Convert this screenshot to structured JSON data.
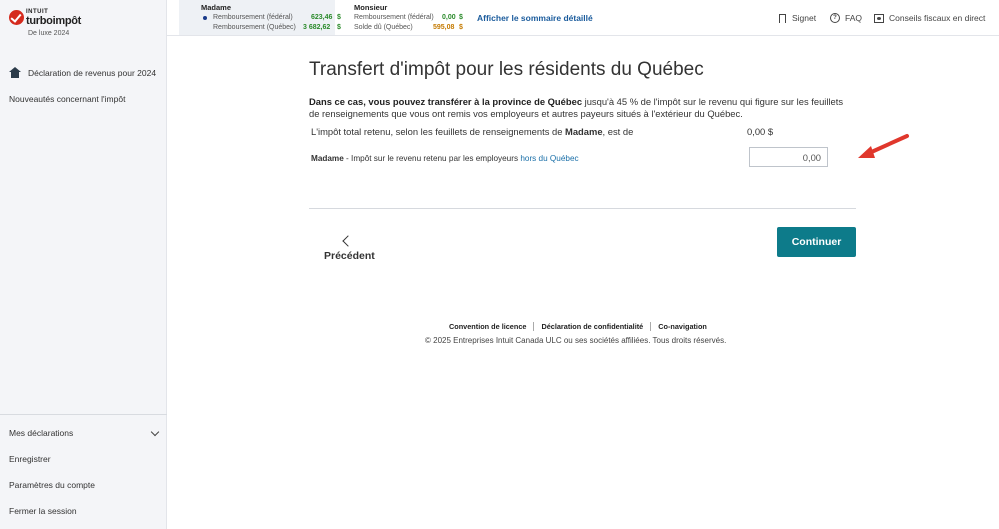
{
  "brand": {
    "intuit": "INTUIT",
    "product": "turboimpôt",
    "edition": "De luxe 2024"
  },
  "sidebar": {
    "items": [
      {
        "label": "Déclaration de revenus pour 2024",
        "icon": "home-icon"
      },
      {
        "label": "Nouveautés concernant l'impôt"
      }
    ],
    "bottom": [
      {
        "label": "Mes déclarations"
      },
      {
        "label": "Enregistrer"
      },
      {
        "label": "Paramètres du compte"
      },
      {
        "label": "Fermer la session"
      }
    ]
  },
  "topbar": {
    "madame": {
      "name": "Madame",
      "federal_label": "Remboursement (fédéral)",
      "federal_amount": "623,46",
      "quebec_label": "Remboursement (Québec)",
      "quebec_amount": "3 682,62",
      "currency": "$"
    },
    "monsieur": {
      "name": "Monsieur",
      "federal_label": "Remboursement (fédéral)",
      "federal_amount": "0,00",
      "quebec_label": "Solde dû (Québec)",
      "quebec_amount": "595,08",
      "currency": "$"
    },
    "detail_link": "Afficher le sommaire détaillé",
    "signet": "Signet",
    "faq": "FAQ",
    "expert": "Conseils fiscaux en direct"
  },
  "main": {
    "title": "Transfert d'impôt pour les résidents du Québec",
    "intro_bold": "Dans ce cas, vous pouvez transférer à la province de Québec",
    "intro_rest": " jusqu'à 45 % de l'impôt sur le revenu qui figure sur les feuillets de renseignements que vous ont remis vos employeurs et autres payeurs situés à l'extérieur du Québec.",
    "total_label_pre": "L'impôt total retenu, selon les feuillets de renseignements de ",
    "total_label_name": "Madame",
    "total_label_post": ", est de",
    "total_value": "0,00 $",
    "input_label_name": "Madame",
    "input_label_mid": " - Impôt sur le revenu retenu par les employeurs ",
    "input_label_link": "hors du Québec",
    "input_value": "0,00",
    "back_label": "Précédent",
    "continue_label": "Continuer"
  },
  "footer": {
    "links": [
      "Convention de licence",
      "Déclaration de confidentialité",
      "Co-navigation"
    ],
    "copyright": "© 2025 Entreprises Intuit Canada ULC ou ses sociétés affiliées. Tous droits réservés."
  },
  "colors": {
    "accent": "#0d7b8a",
    "link": "#1a6fa8",
    "arrow": "#e0372c"
  }
}
